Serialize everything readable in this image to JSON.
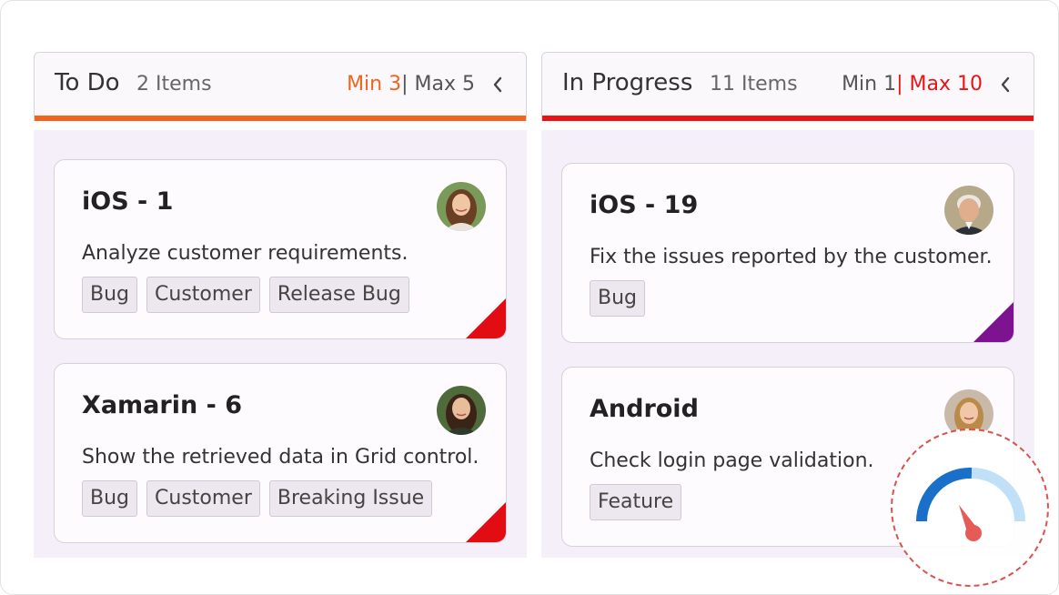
{
  "colors": {
    "todo_accent": "#f0641e",
    "progress_accent": "#e81416",
    "limit_highlight_todo": "#f0641e",
    "limit_highlight_progress": "#e81416",
    "priority_red": "#e10d12",
    "priority_purple": "#7d138f",
    "gauge_dark": "#1a6fc9",
    "gauge_light": "#bfe0f7",
    "gauge_needle": "#e65a57"
  },
  "columns": [
    {
      "title": "To Do",
      "count": "2 Items",
      "min": "Min 3",
      "max": "Max 5",
      "cards": [
        {
          "title": "iOS - 1",
          "description": "Analyze customer requirements.",
          "tags": [
            "Bug",
            "Customer",
            "Release Bug"
          ],
          "avatar": "avatar-woman-smiling",
          "priority": "red"
        },
        {
          "title": "Xamarin - 6",
          "description": "Show the retrieved data in Grid control.",
          "tags": [
            "Bug",
            "Customer",
            "Breaking Issue"
          ],
          "avatar": "avatar-woman-dark-hair",
          "priority": "red"
        }
      ]
    },
    {
      "title": "In Progress",
      "count": "11 Items",
      "min": "Min 1",
      "max": "Max 10",
      "cards": [
        {
          "title": "iOS - 19",
          "description": "Fix the issues reported by the customer.",
          "tags": [
            "Bug"
          ],
          "avatar": "avatar-older-man",
          "priority": "purple"
        },
        {
          "title": "Android",
          "description": "Check login page validation.",
          "tags": [
            "Feature"
          ],
          "avatar": "avatar-woman-blonde",
          "priority": "none"
        }
      ]
    }
  ],
  "separator": "|",
  "icons": {
    "collapse": "chevron-left-icon",
    "overlay": "speedometer-gauge-icon"
  }
}
